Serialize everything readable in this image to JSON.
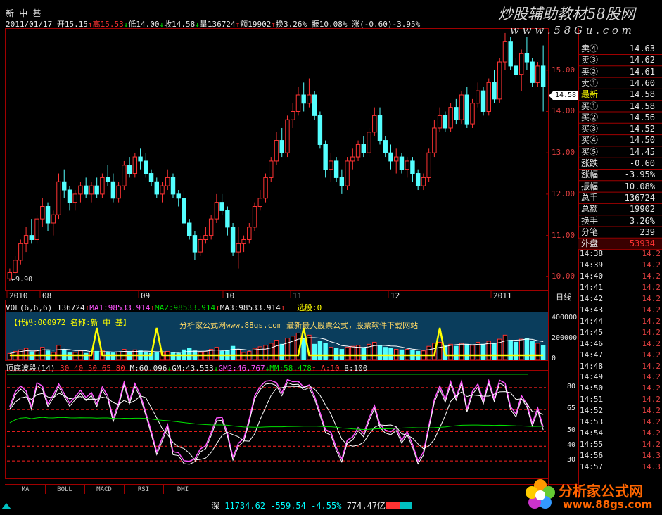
{
  "header": {
    "stock_name": "新 中 基",
    "date": "2011/01/17",
    "open_label": "开",
    "open": "15.15",
    "high_label": "高",
    "high": "15.53",
    "low_label": "低",
    "low": "14.00",
    "close_label": "收",
    "close": "14.58",
    "volume_label": "量",
    "volume": "136724",
    "amount_label": "额",
    "amount": "19902",
    "turnover_label": "换",
    "turnover": "3.26%",
    "amplitude_label": "振",
    "amplitude": "10.08%",
    "change_label": "涨",
    "change": "(-0.60)-3.95%"
  },
  "watermark": {
    "title": "炒股辅助教材58股网",
    "url": "w w w . 5 8 G u . c o m",
    "bottom_brand": "分析家公式网",
    "bottom_url": "www.88gs.com",
    "panel_text": "分析家公式网www.88gs.com 最新最大股票公式，股票软件下载网站"
  },
  "colors": {
    "up": "#ff3333",
    "down": "#54ffff",
    "grid_red": "#ff2020",
    "yellow": "#ffff00",
    "magenta": "#ff55ff",
    "white": "#ffffff",
    "green": "#00e000"
  },
  "price_axis": {
    "ticks": [
      "15.00",
      "14.00",
      "13.00",
      "12.00",
      "11.00",
      "10.00"
    ],
    "current_tag": "14.58",
    "low_marker": "9.90",
    "period_label": "日线"
  },
  "time_axis": [
    "2010",
    "08",
    "09",
    "10",
    "11",
    "12",
    "2011"
  ],
  "volume_panel": {
    "title": "VOL(6,6,6)",
    "vol": "136724",
    "ma1_label": "MA1:",
    "ma1": "98533.914",
    "ma2_label": "MA2:",
    "ma2": "98533.914",
    "ma3_label": "MA3:",
    "ma3": "98533.914",
    "select_label": "选股:0",
    "code_text": "【代码:000972 名称:新 中 基】",
    "ticks": [
      "400000",
      "200000",
      "0"
    ]
  },
  "indicator_panel": {
    "title": "顶底波段(14)",
    "levels": "30 40 50 65 80",
    "m_label": "M:",
    "m": "60.096",
    "gm_label": "GM:",
    "gm": "43.533",
    "gm2_label": "GM2:",
    "gm2": "46.767",
    "mm_label": "MM:",
    "mm": "58.478",
    "a_label": "A:",
    "a": "10",
    "b_label": "B:",
    "b": "100",
    "ticks": [
      "80",
      "65",
      "50",
      "40",
      "30"
    ]
  },
  "tabs": [
    "MA",
    "BOLL",
    "MACD",
    "RSI",
    "DMI"
  ],
  "status_bar": {
    "market": "深",
    "index": "11734.62",
    "change": "-559.54",
    "pct": "-4.55%",
    "amount": "774.47亿"
  },
  "quote_panel": {
    "sells": [
      {
        "label": "卖④",
        "price": "14.63"
      },
      {
        "label": "卖③",
        "price": "14.62"
      },
      {
        "label": "卖②",
        "price": "14.61"
      },
      {
        "label": "卖①",
        "price": "14.60"
      }
    ],
    "latest": {
      "label": "最新",
      "price": "14.58"
    },
    "buys": [
      {
        "label": "买①",
        "price": "14.58"
      },
      {
        "label": "买②",
        "price": "14.56"
      },
      {
        "label": "买③",
        "price": "14.52"
      },
      {
        "label": "买④",
        "price": "14.50"
      },
      {
        "label": "买⑤",
        "price": "14.45"
      }
    ],
    "stats": [
      {
        "label": "涨跌",
        "value": "-0.60"
      },
      {
        "label": "涨幅",
        "value": "-3.95%"
      },
      {
        "label": "振幅",
        "value": "10.08%"
      },
      {
        "label": "总手",
        "value": "136724"
      },
      {
        "label": "总额",
        "value": "19902"
      },
      {
        "label": "换手",
        "value": "3.26%"
      },
      {
        "label": "分笔",
        "value": "239"
      },
      {
        "label": "外盘",
        "value": "53934"
      }
    ],
    "ticks": [
      {
        "time": "14:38",
        "price": "14.2"
      },
      {
        "time": "14:39",
        "price": "14.2"
      },
      {
        "time": "14:40",
        "price": "14.2"
      },
      {
        "time": "14:41",
        "price": "14.2"
      },
      {
        "time": "14:42",
        "price": "14.2"
      },
      {
        "time": "14:43",
        "price": "14.2"
      },
      {
        "time": "14:44",
        "price": "14.2"
      },
      {
        "time": "14:45",
        "price": "14.2"
      },
      {
        "time": "14:46",
        "price": "14.2"
      },
      {
        "time": "14:47",
        "price": "14.2"
      },
      {
        "time": "14:48",
        "price": "14.2"
      },
      {
        "time": "14:49",
        "price": "14.2"
      },
      {
        "time": "14:50",
        "price": "14.2"
      },
      {
        "time": "14:51",
        "price": "14.2"
      },
      {
        "time": "14:52",
        "price": "14.2"
      },
      {
        "time": "14:53",
        "price": "14.2"
      },
      {
        "time": "14:54",
        "price": "14.2"
      },
      {
        "time": "14:55",
        "price": "14.2"
      },
      {
        "time": "14:56",
        "price": "14.3"
      },
      {
        "time": "14:57",
        "price": "14.3"
      }
    ]
  },
  "chart_data": {
    "type": "candlestick",
    "price_range": [
      9.75,
      15.95
    ],
    "candles_ohlc": [
      [
        9.95,
        10.2,
        9.9,
        10.1
      ],
      [
        10.1,
        10.5,
        10.0,
        10.4
      ],
      [
        10.4,
        10.9,
        10.3,
        10.8
      ],
      [
        10.8,
        11.2,
        10.6,
        11.0
      ],
      [
        11.0,
        11.4,
        10.8,
        10.9
      ],
      [
        10.9,
        11.5,
        10.8,
        11.4
      ],
      [
        11.4,
        11.9,
        11.2,
        11.7
      ],
      [
        11.7,
        11.8,
        11.1,
        11.3
      ],
      [
        11.3,
        11.6,
        11.0,
        11.5
      ],
      [
        11.5,
        12.5,
        11.4,
        12.3
      ],
      [
        12.3,
        12.6,
        11.9,
        12.1
      ],
      [
        12.1,
        12.2,
        11.6,
        11.8
      ],
      [
        11.8,
        12.1,
        11.6,
        12.0
      ],
      [
        12.0,
        12.3,
        11.8,
        12.2
      ],
      [
        12.2,
        12.4,
        11.9,
        12.0
      ],
      [
        12.0,
        12.3,
        11.8,
        12.2
      ],
      [
        12.2,
        12.4,
        11.9,
        12.0
      ],
      [
        12.0,
        12.5,
        11.9,
        12.4
      ],
      [
        12.4,
        12.7,
        12.2,
        12.3
      ],
      [
        12.3,
        12.5,
        11.8,
        11.9
      ],
      [
        11.9,
        12.3,
        11.8,
        12.2
      ],
      [
        12.2,
        12.8,
        12.1,
        12.7
      ],
      [
        12.7,
        12.9,
        12.4,
        12.5
      ],
      [
        12.5,
        13.0,
        12.4,
        12.9
      ],
      [
        12.9,
        13.1,
        12.6,
        12.8
      ],
      [
        12.8,
        13.0,
        12.4,
        12.5
      ],
      [
        12.5,
        12.6,
        12.2,
        12.3
      ],
      [
        12.3,
        12.4,
        11.9,
        12.0
      ],
      [
        12.0,
        12.3,
        11.8,
        12.2
      ],
      [
        12.2,
        12.6,
        12.1,
        12.4
      ],
      [
        12.4,
        12.5,
        11.9,
        12.0
      ],
      [
        12.0,
        12.1,
        11.7,
        11.9
      ],
      [
        11.9,
        12.1,
        11.2,
        11.3
      ],
      [
        11.3,
        11.4,
        10.9,
        11.0
      ],
      [
        11.0,
        11.1,
        10.4,
        10.6
      ],
      [
        10.6,
        11.0,
        10.5,
        10.9
      ],
      [
        10.9,
        11.2,
        10.8,
        11.0
      ],
      [
        11.0,
        11.5,
        10.9,
        11.4
      ],
      [
        11.4,
        12.0,
        11.3,
        11.8
      ],
      [
        11.8,
        12.0,
        11.5,
        11.6
      ],
      [
        11.6,
        11.7,
        11.0,
        11.2
      ],
      [
        11.2,
        11.3,
        10.5,
        10.6
      ],
      [
        10.6,
        11.2,
        10.2,
        10.8
      ],
      [
        10.8,
        11.0,
        10.6,
        10.9
      ],
      [
        10.9,
        11.3,
        10.8,
        11.2
      ],
      [
        11.2,
        11.8,
        11.1,
        11.7
      ],
      [
        11.7,
        12.1,
        11.6,
        11.9
      ],
      [
        11.9,
        12.5,
        11.8,
        12.4
      ],
      [
        12.4,
        12.9,
        12.3,
        12.8
      ],
      [
        12.8,
        13.5,
        12.7,
        13.3
      ],
      [
        13.3,
        13.6,
        12.9,
        13.0
      ],
      [
        13.0,
        13.9,
        12.9,
        13.8
      ],
      [
        13.8,
        14.2,
        13.6,
        14.0
      ],
      [
        14.0,
        14.6,
        13.9,
        14.4
      ],
      [
        14.4,
        14.7,
        14.0,
        14.2
      ],
      [
        14.2,
        14.8,
        14.1,
        14.4
      ],
      [
        14.4,
        14.5,
        13.8,
        13.9
      ],
      [
        13.9,
        14.0,
        13.1,
        13.2
      ],
      [
        13.2,
        13.3,
        12.4,
        12.6
      ],
      [
        12.6,
        13.0,
        12.3,
        12.8
      ],
      [
        12.8,
        12.9,
        12.3,
        12.4
      ],
      [
        12.4,
        12.6,
        12.0,
        12.2
      ],
      [
        12.2,
        12.9,
        12.1,
        12.8
      ],
      [
        12.8,
        13.1,
        12.6,
        12.9
      ],
      [
        12.9,
        13.3,
        12.8,
        13.2
      ],
      [
        13.2,
        13.4,
        12.9,
        13.0
      ],
      [
        13.0,
        13.6,
        12.9,
        13.5
      ],
      [
        13.5,
        14.1,
        13.4,
        13.9
      ],
      [
        13.9,
        14.1,
        13.2,
        13.3
      ],
      [
        13.3,
        13.4,
        12.9,
        13.0
      ],
      [
        13.0,
        13.2,
        12.6,
        12.8
      ],
      [
        12.8,
        13.1,
        12.5,
        12.9
      ],
      [
        12.9,
        13.0,
        12.5,
        12.6
      ],
      [
        12.6,
        12.9,
        12.4,
        12.8
      ],
      [
        12.8,
        12.9,
        12.3,
        12.5
      ],
      [
        12.5,
        12.6,
        12.1,
        12.2
      ],
      [
        12.2,
        12.5,
        12.1,
        12.4
      ],
      [
        12.4,
        13.1,
        12.3,
        13.0
      ],
      [
        13.0,
        13.8,
        12.9,
        13.6
      ],
      [
        13.6,
        14.1,
        13.5,
        13.9
      ],
      [
        13.9,
        14.0,
        13.5,
        13.6
      ],
      [
        13.6,
        14.2,
        13.5,
        14.1
      ],
      [
        14.1,
        14.3,
        13.7,
        13.8
      ],
      [
        13.8,
        14.5,
        13.7,
        14.4
      ],
      [
        14.4,
        14.6,
        13.6,
        13.7
      ],
      [
        13.7,
        14.3,
        13.6,
        14.2
      ],
      [
        14.2,
        14.7,
        14.1,
        14.5
      ],
      [
        14.5,
        14.6,
        13.9,
        14.0
      ],
      [
        14.0,
        14.8,
        13.9,
        14.7
      ],
      [
        14.7,
        15.0,
        14.2,
        14.3
      ],
      [
        14.3,
        15.3,
        14.2,
        15.2
      ],
      [
        15.2,
        15.9,
        15.0,
        15.7
      ],
      [
        15.7,
        15.8,
        15.0,
        15.1
      ],
      [
        15.1,
        15.3,
        14.8,
        14.9
      ],
      [
        14.9,
        15.5,
        14.5,
        15.4
      ],
      [
        15.4,
        15.8,
        15.0,
        15.2
      ],
      [
        15.2,
        15.3,
        14.6,
        14.7
      ],
      [
        14.7,
        15.2,
        14.6,
        15.1
      ],
      [
        15.1,
        15.6,
        14.0,
        14.6
      ]
    ],
    "volume": [
      60,
      80,
      95,
      110,
      75,
      90,
      120,
      85,
      70,
      140,
      100,
      65,
      70,
      85,
      60,
      75,
      80,
      90,
      70,
      65,
      75,
      100,
      70,
      95,
      85,
      70,
      60,
      75,
      70,
      80,
      65,
      60,
      95,
      110,
      85,
      70,
      75,
      100,
      120,
      80,
      90,
      130,
      95,
      70,
      80,
      110,
      125,
      140,
      160,
      190,
      150,
      210,
      230,
      260,
      200,
      240,
      150,
      180,
      160,
      120,
      110,
      100,
      120,
      130,
      140,
      110,
      150,
      170,
      140,
      120,
      110,
      100,
      95,
      100,
      90,
      80,
      85,
      130,
      160,
      170,
      140,
      150,
      130,
      160,
      150,
      140,
      170,
      150,
      180,
      160,
      200,
      240,
      190,
      170,
      200,
      210,
      180,
      160,
      140
    ],
    "volume_range": [
      0,
      450000
    ],
    "indicator_lines": {
      "levels": [
        30,
        40,
        50,
        65,
        80
      ],
      "range": [
        20,
        90
      ]
    }
  }
}
